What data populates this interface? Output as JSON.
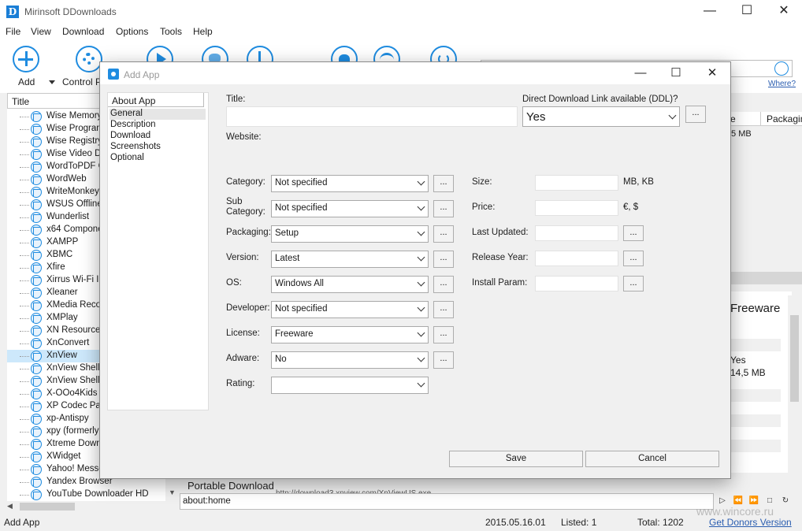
{
  "window": {
    "title": "Mirinsoft DDownloads",
    "logo_letter": "D",
    "minimize": "—",
    "maximize": "☐",
    "close": "✕"
  },
  "menu": [
    "File",
    "View",
    "Download",
    "Options",
    "Tools",
    "Help"
  ],
  "toolbar": {
    "add_label": "Add",
    "control_label": "Control Pa",
    "icons": [
      "plus-icon",
      "gear-icon",
      "play-icon",
      "globe-icon",
      "usb-icon",
      "heart-icon",
      "wifi-icon",
      "power-icon"
    ]
  },
  "search": {
    "where_label": "Where?"
  },
  "list": {
    "header": "Title",
    "items": [
      "Wise Memory",
      "Wise Program",
      "Wise Registry",
      "Wise Video Do",
      "WordToPDF C",
      "WordWeb",
      "WriteMonkey",
      "WSUS Offline",
      "Wunderlist",
      "x64 Compone",
      "XAMPP",
      "XBMC",
      "Xfire",
      "Xirrus Wi-Fi In",
      "Xleaner",
      "XMedia Recod",
      "XMPlay",
      "XN Resource E",
      "XnConvert",
      "XnView",
      "XnView Shell E",
      "XnView Shell E",
      "X-OOo4Kids",
      "XP Codec Pac",
      "xp-Antispy",
      "xpy (formerly",
      "Xtreme Downl",
      "XWidget",
      "Yahoo! Messe",
      "Yandex Browser",
      "YouTube Downloader HD"
    ]
  },
  "background": {
    "col_e": "e",
    "col_packaging": "Packaging",
    "size_val": ".5 MB",
    "license_val": "Freeware",
    "ddl_val": "Yes",
    "size_detail": "14,5 MB",
    "portable_label": "Portable Download",
    "portable_url": "http://download3.xnview.com/XnViewUS.exe",
    "address": "about:home",
    "nav_buttons": [
      "▷",
      "⏪",
      "⏩",
      "□",
      "↻"
    ]
  },
  "status": {
    "left": "Add App",
    "date": "2015.05.16.01",
    "listed": "Listed: 1",
    "total": "Total: 1202",
    "donors": "Get Donors Version"
  },
  "dialog": {
    "title": "Add App",
    "nav_header": "About App",
    "nav_items": [
      "General",
      "Description",
      "Download",
      "Screenshots",
      "Optional"
    ],
    "title_label": "Title:",
    "ddl_label": "Direct Download Link available (DDL)?",
    "ddl_value": "Yes",
    "website_label": "Website:",
    "dots": "...",
    "fields": [
      {
        "label": "Category:",
        "value": "Not specified"
      },
      {
        "label": "Sub\nCategory:",
        "value": "Not specified"
      },
      {
        "label": "Packaging:",
        "value": "Setup"
      },
      {
        "label": "Version:",
        "value": "Latest"
      },
      {
        "label": "OS:",
        "value": "Windows All"
      },
      {
        "label": "Developer:",
        "value": "Not specified"
      },
      {
        "label": "License:",
        "value": "Freeware"
      },
      {
        "label": "Adware:",
        "value": "No"
      },
      {
        "label": "Rating:",
        "value": ""
      }
    ],
    "right_fields": [
      {
        "label": "Size:",
        "unit": "MB, KB"
      },
      {
        "label": "Price:",
        "unit": "€, $"
      },
      {
        "label": "Last Updated:",
        "unit": ""
      },
      {
        "label": "Release Year:",
        "unit": ""
      },
      {
        "label": "Install Param:",
        "unit": ""
      }
    ],
    "save": "Save",
    "cancel": "Cancel"
  },
  "watermark": "www.wincore.ru"
}
